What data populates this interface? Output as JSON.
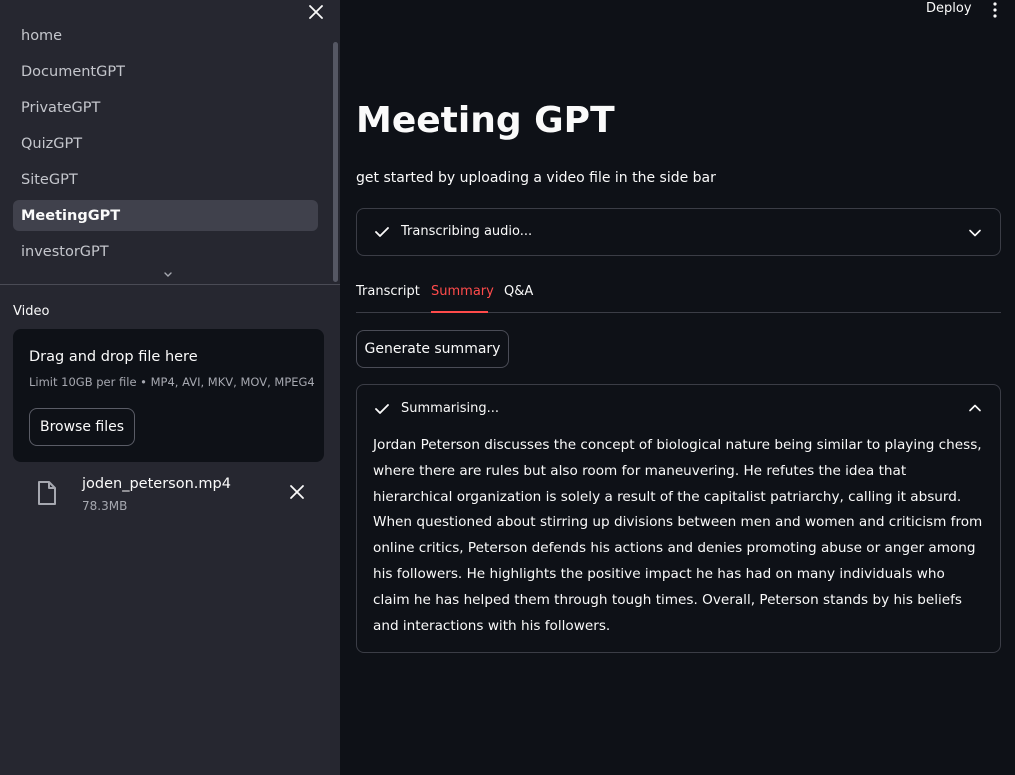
{
  "sidebar": {
    "nav_items": [
      {
        "label": "home"
      },
      {
        "label": "DocumentGPT"
      },
      {
        "label": "PrivateGPT"
      },
      {
        "label": "QuizGPT"
      },
      {
        "label": "SiteGPT"
      },
      {
        "label": "MeetingGPT",
        "active": true
      },
      {
        "label": "investorGPT"
      }
    ],
    "uploader": {
      "label": "Video",
      "drop_title": "Drag and drop file here",
      "limit_text": "Limit 10GB per file • MP4, AVI, MKV, MOV, MPEG4",
      "browse_label": "Browse files"
    },
    "file": {
      "name": "joden_peterson.mp4",
      "size": "78.3MB"
    }
  },
  "header": {
    "deploy_label": "Deploy"
  },
  "main": {
    "title": "Meeting GPT",
    "subtitle": "get started by uploading a video file in the side bar",
    "status": {
      "label": "Transcribing audio..."
    },
    "tabs": [
      {
        "label": "Transcript"
      },
      {
        "label": "Summary",
        "active": true
      },
      {
        "label": "Q&A"
      }
    ],
    "generate_button": "Generate summary",
    "summary": {
      "label": "Summarising...",
      "text": "Jordan Peterson discusses the concept of biological nature being similar to playing chess, where there are rules but also room for maneuvering. He refutes the idea that hierarchical organization is solely a result of the capitalist patriarchy, calling it absurd. When questioned about stirring up divisions between men and women and criticism from online critics, Peterson defends his actions and denies promoting abuse or anger among his followers. He highlights the positive impact he has had on many individuals who claim he has helped them through tough times. Overall, Peterson stands by his beliefs and interactions with his followers."
    }
  },
  "colors": {
    "background": "#0e1117",
    "sidebar": "#262730",
    "accent": "#ff4b4b",
    "text": "#fafafa"
  }
}
